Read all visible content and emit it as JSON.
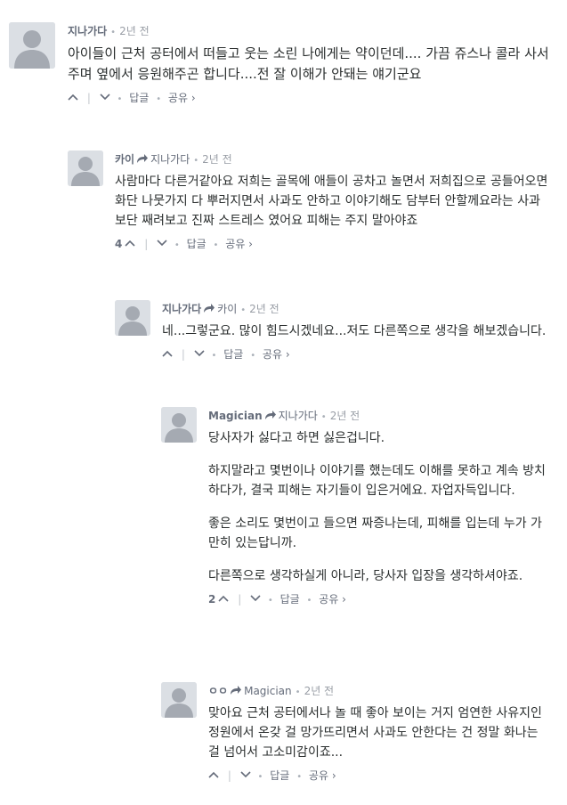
{
  "comments": [
    {
      "author": "지나가다",
      "reply_to": "",
      "time": "2년 전",
      "paragraphs": [
        "아이들이 근처 공터에서 떠들고 웃는 소린 나에게는 약이던데.... 가끔 쥬스나 콜라 사서 주며 옆에서 응원해주곤 합니다....전 잘 이해가 안돼는 얘기군요"
      ],
      "votes": "",
      "reply_label": "답글",
      "share_label": "공유 ›"
    },
    {
      "author": "카이",
      "reply_to": "지나가다",
      "time": "2년 전",
      "paragraphs": [
        "사람마다 다른거같아요 저희는 골목에 애들이 공차고 놀면서 저희집으로 공들어오면 화단 나뭇가지 다 뿌러지면서 사과도 안하고 이야기해도 담부터 안할께요라는 사과보단 째려보고 진짜 스트레스 였어요 피해는 주지 말아야죠"
      ],
      "votes": "4",
      "reply_label": "답글",
      "share_label": "공유 ›"
    },
    {
      "author": "지나가다",
      "reply_to": "카이",
      "time": "2년 전",
      "paragraphs": [
        "네...그렇군요. 많이 힘드시겠네요...저도 다른쪽으로 생각을 해보겠습니다."
      ],
      "votes": "",
      "reply_label": "답글",
      "share_label": "공유 ›"
    },
    {
      "author": "Magician",
      "reply_to": "지나가다",
      "time": "2년 전",
      "paragraphs": [
        "당사자가 싫다고 하면 싫은겁니다.",
        "하지말라고 몇번이나 이야기를 했는데도 이해를 못하고 계속 방치하다가, 결국 피해는 자기들이 입은거에요. 자업자득입니다.",
        "좋은 소리도 몇번이고 들으면 짜증나는데, 피해를 입는데 누가 가만히 있는답니까.",
        "다른쪽으로 생각하실게 아니라, 당사자 입장을 생각하셔야죠."
      ],
      "votes": "2",
      "reply_label": "답글",
      "share_label": "공유 ›"
    },
    {
      "author": "ㅇㅇ",
      "reply_to": "Magician",
      "time": "2년 전",
      "paragraphs": [
        "맞아요 근처 공터에서나 놀 때 좋아 보이는 거지 엄연한 사유지인 정원에서 온갖 걸 망가뜨리면서 사과도 안한다는 건 정말 화나는 걸 넘어서 고소미감이죠..."
      ],
      "votes": "",
      "reply_label": "답글",
      "share_label": "공유 ›"
    }
  ]
}
